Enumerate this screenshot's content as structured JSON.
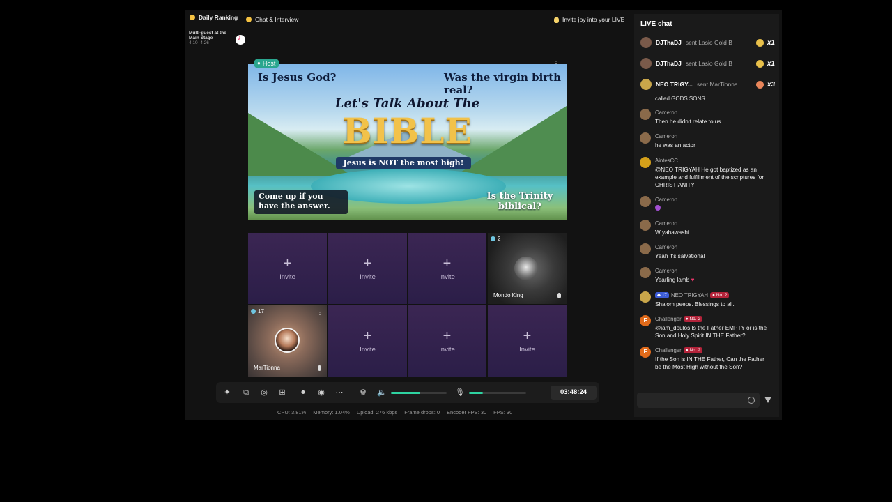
{
  "topbar": {
    "daily_ranking": "Daily Ranking",
    "chat_interview": "Chat & Interview",
    "invite_joy": "Invite joy into your LIVE",
    "event_title": "Multi-guest at the Main Stage",
    "event_dates": "4.10–4.26"
  },
  "stage": {
    "host_label": "Host",
    "banner": {
      "q1": "Is Jesus God?",
      "q2": "Was the virgin birth real?",
      "script": "Let's Talk About The",
      "main": "BIBLE",
      "sub": "Jesus is NOT the most high!",
      "box": "Come up if you have the answer.",
      "trinity": "Is the Trinity biblical?"
    },
    "invite_label": "Invite",
    "guests": [
      {
        "num": "2",
        "name": "Mondo King"
      },
      {
        "num": "17",
        "name": "MarTionna"
      }
    ]
  },
  "controls": {
    "timer": "03:48:24",
    "volume_level": 0.52,
    "mic_level": 0.24
  },
  "stats": {
    "cpu": "CPU: 3.81%",
    "memory": "Memory: 1.04%",
    "upload": "Upload: 276 kbps",
    "frame_drops": "Frame drops: 0",
    "encoder_fps": "Encoder FPS: 30",
    "fps": "FPS: 30"
  },
  "chat": {
    "title": "LIVE chat",
    "gifts": [
      {
        "name": "DJThaDJ",
        "sent": "sent Lasio Gold B",
        "count": "x1"
      },
      {
        "name": "DJThaDJ",
        "sent": "sent Lasio Gold B",
        "count": "x1"
      },
      {
        "name": "NEO TRIGY...",
        "sent": "sent MarTionna",
        "count": "x3"
      }
    ],
    "partial": "called GODS SONS.",
    "messages": [
      {
        "user": "Cameron",
        "text": "Then he didn't relate to us"
      },
      {
        "user": "Cameron",
        "text": "he was an actor"
      },
      {
        "user": "AintesCC",
        "text": "@NEO TRIGYAH He got baptized as an example and fulfillment of the scriptures for CHRISTIANITY"
      },
      {
        "user": "Cameron",
        "text": ""
      },
      {
        "user": "Cameron",
        "text": "W yahawashi"
      },
      {
        "user": "Cameron",
        "text": "Yeah it's salvational"
      },
      {
        "user": "Cameron",
        "text": "Yearling lamb"
      },
      {
        "user": "NEO TRIGYAH",
        "level": "17",
        "badge": "No. 2",
        "text": "Shalom peeps. Blessings to all."
      },
      {
        "user": "Challenger",
        "badge": "No. 2",
        "text": "@iam_doulos Is the Father EMPTY or is the Son and Holy Spirit IN THE Father?"
      },
      {
        "user": "Challenger",
        "badge": "No. 2",
        "text": "If the Son is IN THE Father, Can the Father be the Most High without the Son?"
      }
    ],
    "avatar_letter": "F"
  }
}
